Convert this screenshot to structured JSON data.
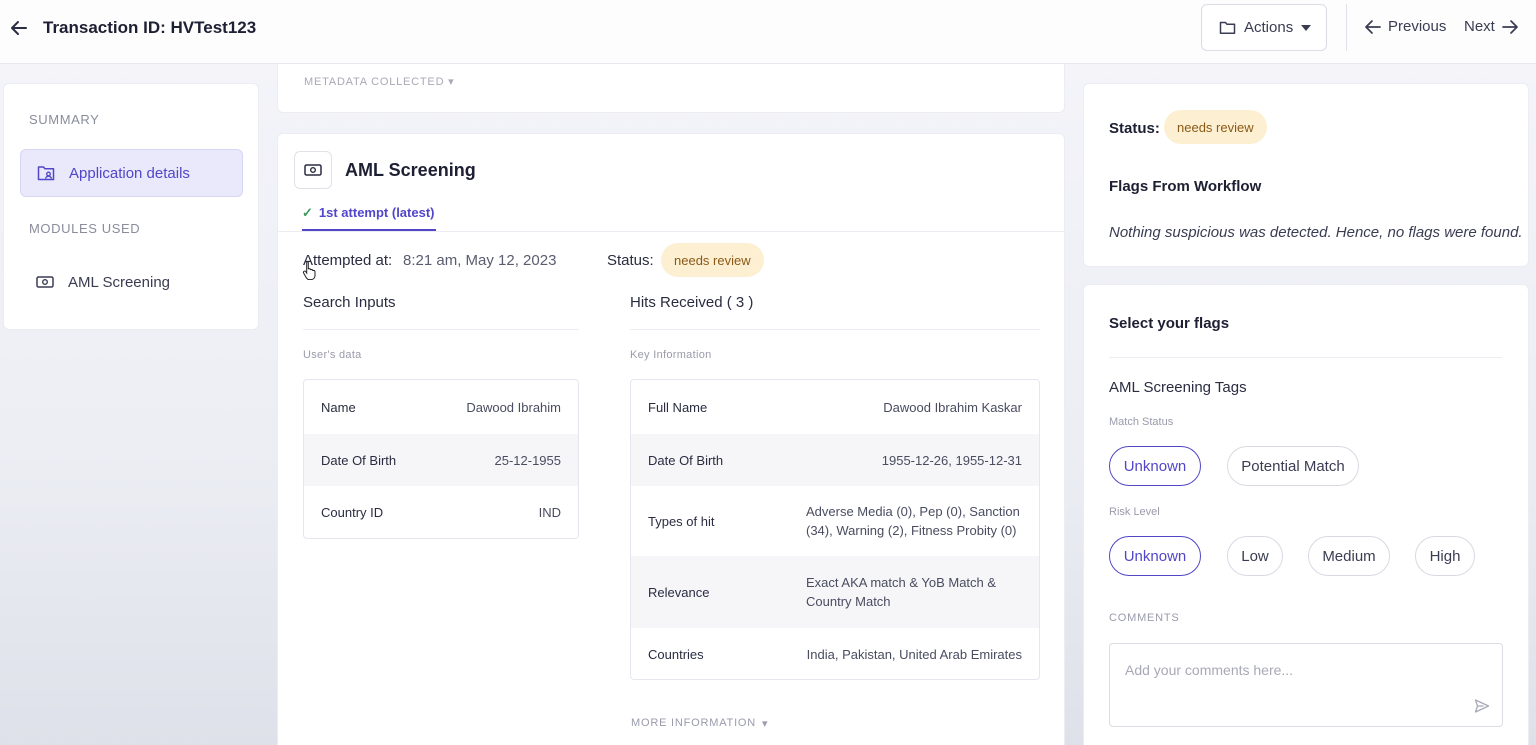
{
  "header": {
    "title": "Transaction ID: HVTest123",
    "actions_label": "Actions",
    "previous_label": "Previous",
    "next_label": "Next"
  },
  "sidebar": {
    "summary_heading": "SUMMARY",
    "application_details": "Application details",
    "modules_heading": "MODULES USED",
    "modules": [
      {
        "label": "AML Screening",
        "icon": "money-icon"
      }
    ]
  },
  "main": {
    "metadata_label": "METADATA COLLECTED",
    "module_title": "AML Screening",
    "attempt_tab": "1st attempt (latest)",
    "attempted_at_label": "Attempted at:",
    "attempted_at_value": "8:21 am, May 12, 2023",
    "status_label": "Status:",
    "status_value": "needs review",
    "search_inputs_heading": "Search Inputs",
    "users_data_label": "User's data",
    "user_data": [
      {
        "key": "Name",
        "value": "Dawood Ibrahim"
      },
      {
        "key": "Date Of Birth",
        "value": "25-12-1955"
      },
      {
        "key": "Country ID",
        "value": "IND"
      }
    ],
    "hits_heading": "Hits Received ( 3 )",
    "key_info_label": "Key Information",
    "key_info": [
      {
        "key": "Full Name",
        "value": "Dawood Ibrahim Kaskar"
      },
      {
        "key": "Date Of Birth",
        "value": "1955-12-26, 1955-12-31"
      },
      {
        "key": "Types of hit",
        "value": "Adverse Media (0), Pep (0), Sanction (34), Warning (2), Fitness Probity (0)"
      },
      {
        "key": "Relevance",
        "value": "Exact AKA match & YoB Match & Country Match"
      },
      {
        "key": "Countries",
        "value": "India, Pakistan, United Arab Emirates"
      }
    ],
    "more_information": "MORE INFORMATION"
  },
  "right": {
    "status_label": "Status:",
    "status_value": "needs review",
    "flags_heading": "Flags From Workflow",
    "flags_message": "Nothing suspicious was detected. Hence, no flags were found.",
    "select_flags_heading": "Select your flags",
    "tags_heading": "AML Screening Tags",
    "match_status_label": "Match Status",
    "match_status_options": [
      "Unknown",
      "Potential Match"
    ],
    "match_status_selected": "Unknown",
    "risk_level_label": "Risk Level",
    "risk_level_options": [
      "Unknown",
      "Low",
      "Medium",
      "High"
    ],
    "risk_level_selected": "Unknown",
    "comments_label": "COMMENTS",
    "comments_placeholder": "Add your comments here..."
  },
  "colors": {
    "accent": "#5146c8",
    "badge_bg": "#fdefd2",
    "badge_text": "#8a5a16"
  }
}
